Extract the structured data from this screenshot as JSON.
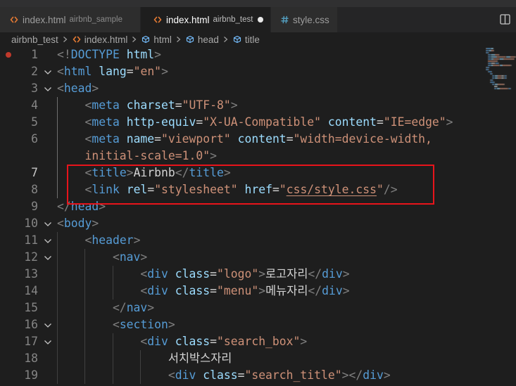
{
  "tabs": [
    {
      "icon": "html-file-icon",
      "label": "index.html",
      "description": "airbnb_sample",
      "active": false,
      "dirty": false
    },
    {
      "icon": "html-file-icon",
      "label": "index.html",
      "description": "airbnb_test",
      "active": true,
      "dirty": true
    },
    {
      "icon": "css-file-icon",
      "label": "style.css",
      "active": false,
      "dirty": false
    }
  ],
  "toolbar": {
    "split_icon": "split-editor-icon"
  },
  "breadcrumb": [
    {
      "label": "airbnb_test"
    },
    {
      "icon": "html-file-icon",
      "label": "index.html"
    },
    {
      "icon": "symbol-field-icon",
      "label": "html"
    },
    {
      "icon": "symbol-field-icon",
      "label": "head"
    },
    {
      "icon": "symbol-field-icon",
      "label": "title"
    }
  ],
  "editor": {
    "active_line": 7,
    "gutter_marker_line": 1,
    "lines": [
      {
        "n": 1,
        "indent": 0,
        "tokens": [
          {
            "punct": "<!"
          },
          {
            "tag": "DOCTYPE"
          },
          {
            "attr": " html"
          },
          {
            "punct": ">"
          }
        ]
      },
      {
        "n": 2,
        "indent": 0,
        "fold": true,
        "tokens": [
          {
            "punct": "<"
          },
          {
            "tag": "html"
          },
          {
            "attr": " lang"
          },
          {
            "eq": "="
          },
          {
            "str": "\"en\""
          },
          {
            "punct": ">"
          }
        ]
      },
      {
        "n": 3,
        "indent": 0,
        "fold": true,
        "tokens": [
          {
            "punct": "<"
          },
          {
            "tag": "head"
          },
          {
            "punct": ">"
          }
        ]
      },
      {
        "n": 4,
        "indent": 4,
        "tokens": [
          {
            "punct": "<"
          },
          {
            "tag": "meta"
          },
          {
            "attr": " charset"
          },
          {
            "eq": "="
          },
          {
            "str": "\"UTF-8\""
          },
          {
            "punct": ">"
          }
        ]
      },
      {
        "n": 5,
        "indent": 4,
        "tokens": [
          {
            "punct": "<"
          },
          {
            "tag": "meta"
          },
          {
            "attr": " http-equiv"
          },
          {
            "eq": "="
          },
          {
            "str": "\"X-UA-Compatible\""
          },
          {
            "attr": " content"
          },
          {
            "eq": "="
          },
          {
            "str": "\"IE=edge\""
          },
          {
            "punct": ">"
          }
        ]
      },
      {
        "n": 6,
        "indent": 4,
        "tokens": [
          {
            "punct": "<"
          },
          {
            "tag": "meta"
          },
          {
            "attr": " name"
          },
          {
            "eq": "="
          },
          {
            "str": "\"viewport\""
          },
          {
            "attr": " content"
          },
          {
            "eq": "="
          },
          {
            "str": "\"width=device-width,"
          }
        ]
      },
      {
        "indent": 4,
        "tokens": [
          {
            "str": "initial-scale=1.0\""
          },
          {
            "punct": ">"
          }
        ]
      },
      {
        "n": 7,
        "indent": 4,
        "tokens": [
          {
            "punct": "<"
          },
          {
            "tag": "title"
          },
          {
            "punct": ">"
          },
          {
            "text": "Airbnb"
          },
          {
            "punct": "</"
          },
          {
            "tag": "title"
          },
          {
            "punct": ">"
          }
        ]
      },
      {
        "n": 8,
        "indent": 4,
        "tokens": [
          {
            "punct": "<"
          },
          {
            "tag": "link"
          },
          {
            "attr": " rel"
          },
          {
            "eq": "="
          },
          {
            "str": "\"stylesheet\""
          },
          {
            "attr": " href"
          },
          {
            "eq": "="
          },
          {
            "str": "\""
          },
          {
            "link": "css/style.css"
          },
          {
            "str": "\""
          },
          {
            "punct": "/>"
          }
        ]
      },
      {
        "n": 9,
        "indent": 0,
        "tokens": [
          {
            "punct": "</"
          },
          {
            "tag": "head"
          },
          {
            "punct": ">"
          }
        ]
      },
      {
        "n": 10,
        "indent": 0,
        "fold": true,
        "tokens": [
          {
            "punct": "<"
          },
          {
            "tag": "body"
          },
          {
            "punct": ">"
          }
        ]
      },
      {
        "n": 11,
        "indent": 4,
        "fold": true,
        "tokens": [
          {
            "punct": "<"
          },
          {
            "tag": "header"
          },
          {
            "punct": ">"
          }
        ]
      },
      {
        "n": 12,
        "indent": 8,
        "fold": true,
        "tokens": [
          {
            "punct": "<"
          },
          {
            "tag": "nav"
          },
          {
            "punct": ">"
          }
        ]
      },
      {
        "n": 13,
        "indent": 12,
        "tokens": [
          {
            "punct": "<"
          },
          {
            "tag": "div"
          },
          {
            "attr": " class"
          },
          {
            "eq": "="
          },
          {
            "str": "\"logo\""
          },
          {
            "punct": ">"
          },
          {
            "text": "로고자리"
          },
          {
            "punct": "</"
          },
          {
            "tag": "div"
          },
          {
            "punct": ">"
          }
        ]
      },
      {
        "n": 14,
        "indent": 12,
        "tokens": [
          {
            "punct": "<"
          },
          {
            "tag": "div"
          },
          {
            "attr": " class"
          },
          {
            "eq": "="
          },
          {
            "str": "\"menu\""
          },
          {
            "punct": ">"
          },
          {
            "text": "메뉴자리"
          },
          {
            "punct": "</"
          },
          {
            "tag": "div"
          },
          {
            "punct": ">"
          }
        ]
      },
      {
        "n": 15,
        "indent": 8,
        "tokens": [
          {
            "punct": "</"
          },
          {
            "tag": "nav"
          },
          {
            "punct": ">"
          }
        ]
      },
      {
        "n": 16,
        "indent": 8,
        "fold": true,
        "tokens": [
          {
            "punct": "<"
          },
          {
            "tag": "section"
          },
          {
            "punct": ">"
          }
        ]
      },
      {
        "n": 17,
        "indent": 12,
        "fold": true,
        "tokens": [
          {
            "punct": "<"
          },
          {
            "tag": "div"
          },
          {
            "attr": " class"
          },
          {
            "eq": "="
          },
          {
            "str": "\"search_box\""
          },
          {
            "punct": ">"
          }
        ]
      },
      {
        "n": 18,
        "indent": 16,
        "tokens": [
          {
            "text": "서치박스자리"
          }
        ]
      },
      {
        "n": 19,
        "indent": 16,
        "tokens": [
          {
            "punct": "<"
          },
          {
            "tag": "div"
          },
          {
            "attr": " class"
          },
          {
            "eq": "="
          },
          {
            "str": "\"search_title\""
          },
          {
            "punct": "></"
          },
          {
            "tag": "div"
          },
          {
            "punct": ">"
          }
        ]
      }
    ]
  },
  "colors": {
    "editor_background": "#1e1e1e",
    "tab_bar": "#252526",
    "inactive_tab": "#2d2d2d",
    "html_icon": "#e37933",
    "css_icon": "#519aba",
    "symbol_icon": "#75beff",
    "tag": "#569cd6",
    "attribute": "#9cdcfe",
    "string": "#ce9178",
    "punctuation": "#808080",
    "text": "#d4d4d4",
    "line_number": "#858585",
    "active_line_number": "#c6c6c6",
    "gutter_marker": "#c0392b",
    "annotation": "#e8141b"
  }
}
